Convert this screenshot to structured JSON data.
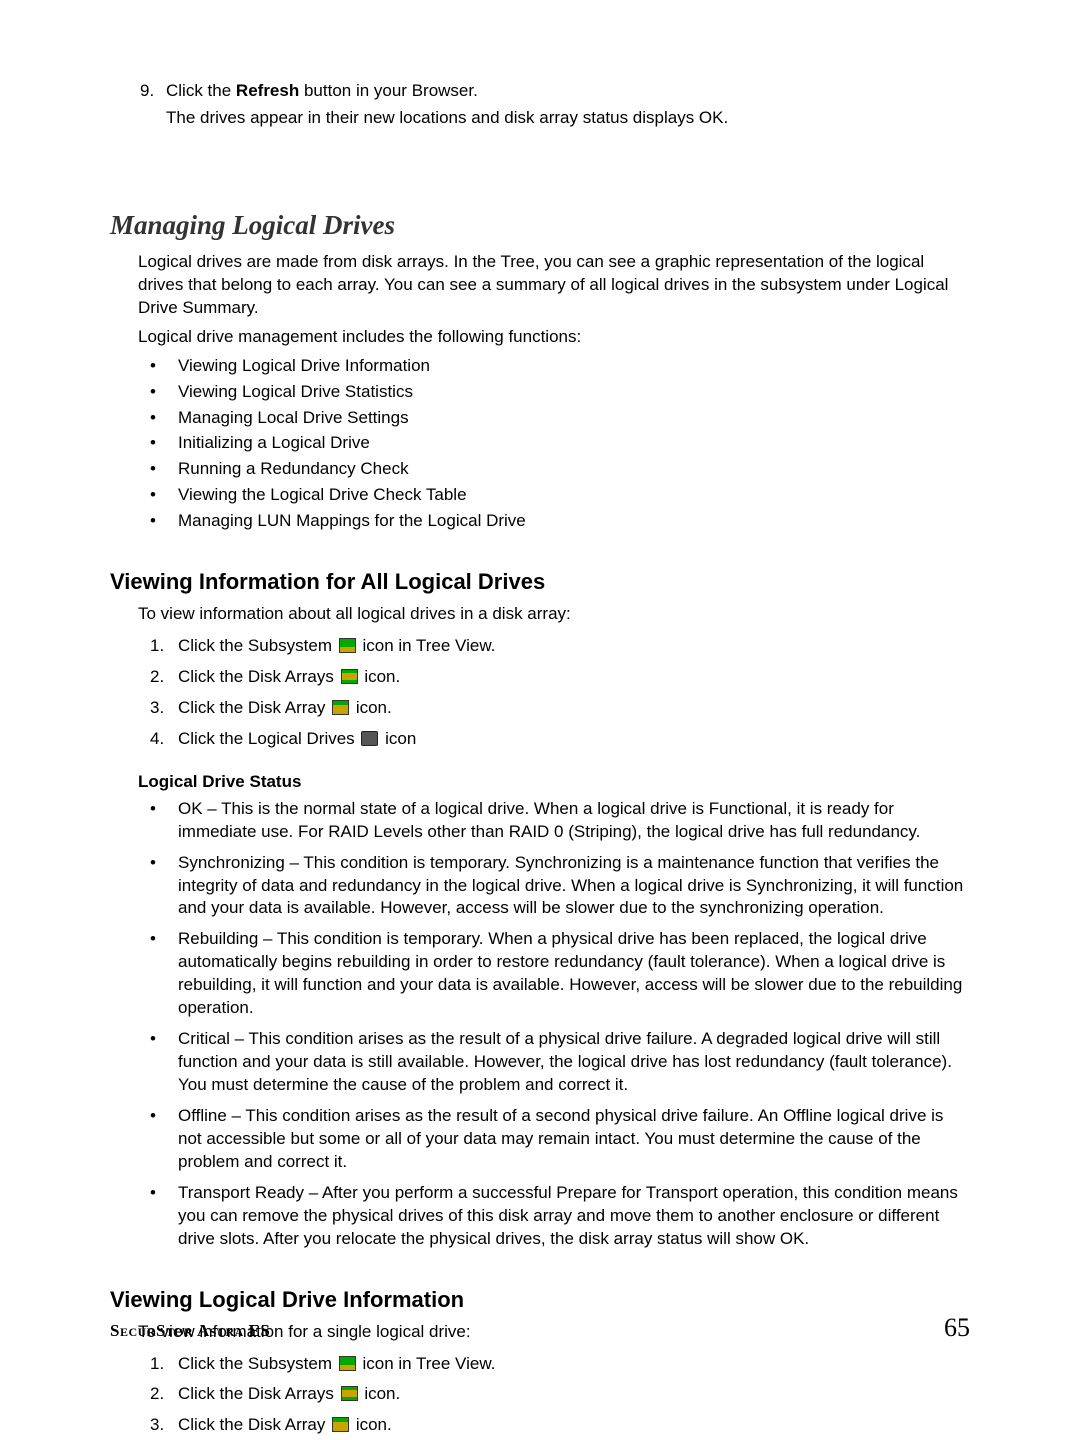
{
  "step9": {
    "num": "9.",
    "line1_pre": "Click the ",
    "line1_bold": "Refresh",
    "line1_post": " button in your Browser.",
    "line2": "The drives appear in their new locations and disk array status displays OK."
  },
  "main_heading": "Managing Logical Drives",
  "intro_p1": "Logical drives are made from disk arrays. In the Tree, you can see a graphic representation of the logical drives that belong to each array. You can see a summary of all logical drives in the subsystem under Logical Drive Summary.",
  "intro_p2": "Logical drive management includes the following functions:",
  "func_items": [
    "Viewing Logical Drive Information",
    "Viewing Logical Drive Statistics",
    "Managing Local Drive Settings",
    "Initializing a Logical Drive",
    "Running a Redundancy Check",
    "Viewing the Logical Drive Check Table",
    "Managing LUN Mappings for the Logical Drive"
  ],
  "sec1_heading": "Viewing Information for All Logical Drives",
  "sec1_intro": "To view information about all logical drives in a disk array:",
  "sec1_steps": [
    {
      "pre": "Click the Subsystem ",
      "post": " icon in Tree View.",
      "icon": "subsystem"
    },
    {
      "pre": "Click the Disk Arrays ",
      "post": " icon.",
      "icon": "arrays"
    },
    {
      "pre": "Click the Disk Array ",
      "post": " icon.",
      "icon": "array"
    },
    {
      "pre": "Click the Logical Drives ",
      "post": " icon",
      "icon": "logical"
    }
  ],
  "lds_heading": "Logical Drive Status",
  "status_items": [
    "OK – This is the normal state of a logical drive. When a logical drive is Functional, it is ready for immediate use. For RAID Levels other than RAID 0 (Striping), the logical drive has full redundancy.",
    "Synchronizing – This condition is temporary. Synchronizing is a maintenance function that verifies the integrity of data and redundancy in the logical drive. When a logical drive is Synchronizing, it will function and your data is available. However, access will be slower due to the synchronizing operation.",
    "Rebuilding – This condition is temporary. When a physical drive has been replaced, the logical drive automatically begins rebuilding in order to restore redundancy (fault tolerance). When a logical drive is rebuilding, it will function and your data is available. However, access will be slower due to the rebuilding operation.",
    "Critical – This condition arises as the result of a physical drive failure. A degraded logical drive will still function and your data is still available. However, the logical drive has lost redundancy (fault tolerance). You must determine the cause of the problem and correct it.",
    "Offline – This condition arises as the result of a second physical drive failure. An Offline logical drive is not accessible but some or all of your data may remain intact. You must determine the cause of the problem and correct it.",
    "Transport Ready – After you perform a successful Prepare for Transport operation, this condition means you can remove the physical drives of this disk array and move them to another enclosure or different drive slots. After you relocate the physical drives, the disk array status will show OK."
  ],
  "sec2_heading": "Viewing Logical Drive Information",
  "sec2_intro": "To view information for a single logical drive:",
  "sec2_steps": [
    {
      "pre": "Click the Subsystem ",
      "post": " icon in Tree View.",
      "icon": "subsystem"
    },
    {
      "pre": "Click the Disk Arrays ",
      "post": " icon.",
      "icon": "arrays"
    },
    {
      "pre": "Click the Disk Array ",
      "post": " icon.",
      "icon": "array"
    }
  ],
  "footer_left": "SecurStor Astra ES",
  "footer_right": "65"
}
